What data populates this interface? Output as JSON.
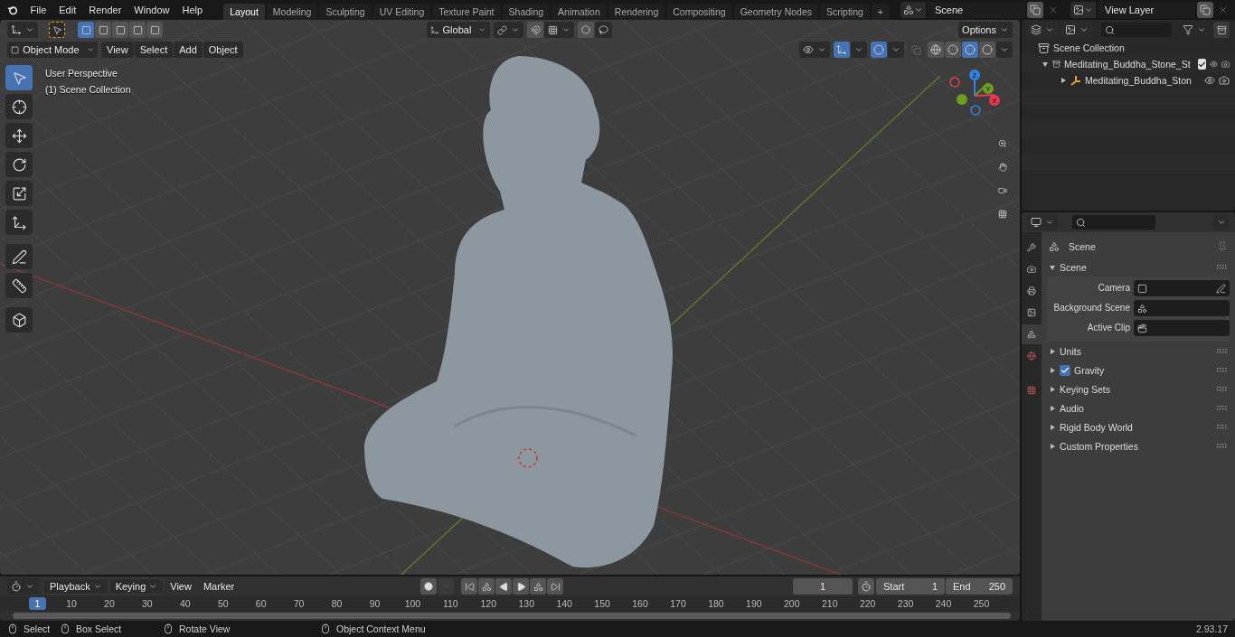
{
  "menu_bar": {
    "menus": [
      "File",
      "Edit",
      "Render",
      "Window",
      "Help"
    ]
  },
  "workspace_tabs": [
    {
      "label": "Layout",
      "selected": true
    },
    {
      "label": "Modeling",
      "selected": false
    },
    {
      "label": "Sculpting",
      "selected": false
    },
    {
      "label": "UV Editing",
      "selected": false
    },
    {
      "label": "Texture Paint",
      "selected": false
    },
    {
      "label": "Shading",
      "selected": false
    },
    {
      "label": "Animation",
      "selected": false
    },
    {
      "label": "Rendering",
      "selected": false
    },
    {
      "label": "Compositing",
      "selected": false
    },
    {
      "label": "Geometry Nodes",
      "selected": false
    },
    {
      "label": "Scripting",
      "selected": false
    }
  ],
  "add_workspace": "+",
  "scene_selector": {
    "value": "Scene"
  },
  "view_layer_selector": {
    "value": "View Layer"
  },
  "viewport": {
    "select_modes": [
      {
        "selected": true
      },
      {
        "selected": false
      },
      {
        "selected": false
      },
      {
        "selected": false
      },
      {
        "selected": false
      }
    ],
    "transform_orientation": "Global",
    "options": "Options",
    "mode": "Object Mode",
    "menus": [
      "View",
      "Select",
      "Add",
      "Object"
    ],
    "shading_modes": [
      {
        "selected": false
      },
      {
        "selected": false
      },
      {
        "selected": true
      },
      {
        "selected": false
      }
    ],
    "overlay_text": [
      "User Perspective",
      "(1) Scene Collection"
    ],
    "tools": [
      {
        "kind": "select",
        "selected": true
      },
      {
        "kind": "cursor",
        "selected": false
      },
      {
        "kind": "move",
        "selected": false
      },
      {
        "kind": "rotate",
        "selected": false
      },
      {
        "kind": "scale",
        "selected": false
      },
      {
        "kind": "transform",
        "selected": false
      },
      {
        "kind": "annotate",
        "selected": false
      },
      {
        "kind": "measure",
        "selected": false
      },
      {
        "kind": "add",
        "selected": false
      }
    ],
    "gizmo_axes": [
      {
        "label": "Y",
        "color": "#6b9e1f"
      },
      {
        "label": "X",
        "color": "#e83a4f"
      },
      {
        "label": "Z",
        "color": "#2f84e3"
      }
    ]
  },
  "outliner": {
    "root": "Scene Collection",
    "items": [
      {
        "label": "Meditating_Buddha_Stone_St",
        "expanded": true,
        "checked": true,
        "children": [
          {
            "label": "Meditating_Buddha_Ston",
            "expanded": false
          }
        ]
      }
    ]
  },
  "properties": {
    "tabs": [
      {
        "kind": "tool",
        "selected": false
      },
      {
        "kind": "render",
        "selected": false
      },
      {
        "kind": "output",
        "selected": false
      },
      {
        "kind": "view_layer",
        "selected": false
      },
      {
        "kind": "scene",
        "selected": true
      },
      {
        "kind": "world",
        "selected": false
      },
      {
        "kind": "texture",
        "selected": false
      }
    ],
    "context": "Scene",
    "panels": [
      {
        "title": "Scene",
        "expanded": true,
        "fields": [
          {
            "label": "Camera",
            "kind": "camera"
          },
          {
            "label": "Background Scene",
            "kind": "scene"
          },
          {
            "label": "Active Clip",
            "kind": "clip"
          }
        ]
      },
      {
        "title": "Units",
        "expanded": false
      },
      {
        "title": "Gravity",
        "expanded": false,
        "checked": true
      },
      {
        "title": "Keying Sets",
        "expanded": false
      },
      {
        "title": "Audio",
        "expanded": false
      },
      {
        "title": "Rigid Body World",
        "expanded": false
      },
      {
        "title": "Custom Properties",
        "expanded": false
      }
    ]
  },
  "timeline": {
    "menus": [
      "Playback",
      "Keying",
      "View",
      "Marker"
    ],
    "current_frame": "1",
    "start_label": "Start",
    "start": "1",
    "end_label": "End",
    "end": "250",
    "playhead": "1",
    "ruler": [
      "10",
      "20",
      "30",
      "40",
      "50",
      "60",
      "70",
      "80",
      "90",
      "100",
      "110",
      "120",
      "130",
      "140",
      "150",
      "160",
      "170",
      "180",
      "190",
      "200",
      "210",
      "220",
      "230",
      "240",
      "250"
    ]
  },
  "status_bar": {
    "hints": [
      "Select",
      "Box Select",
      "Rotate View",
      "Object Context Menu"
    ],
    "version": "2.93.17"
  }
}
